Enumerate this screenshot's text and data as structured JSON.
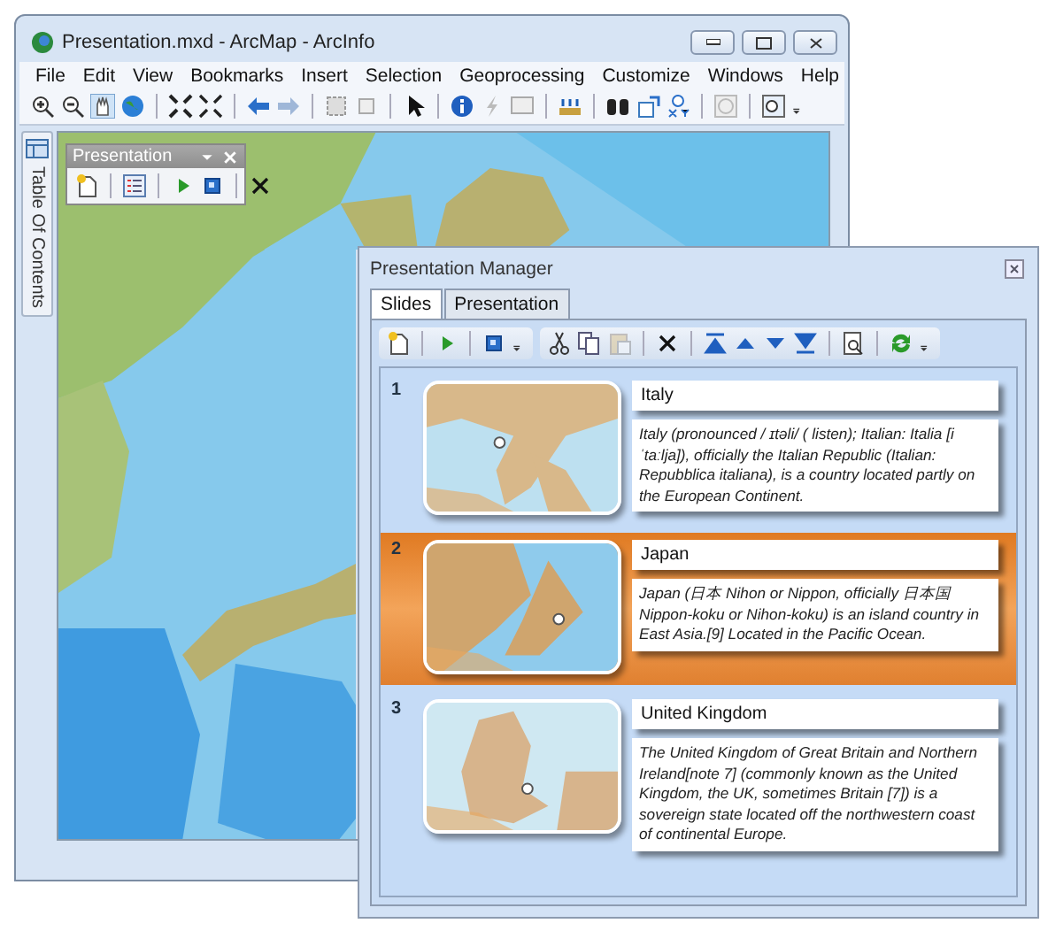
{
  "main_window": {
    "title": "Presentation.mxd - ArcMap - ArcInfo",
    "menu": [
      "File",
      "Edit",
      "View",
      "Bookmarks",
      "Insert",
      "Selection",
      "Geoprocessing",
      "Customize",
      "Windows",
      "Help"
    ],
    "toc_tab": "Table Of Contents",
    "floating_toolbar": {
      "title": "Presentation"
    }
  },
  "manager": {
    "title": "Presentation Manager",
    "tabs": [
      {
        "label": "Slides",
        "selected": true
      },
      {
        "label": "Presentation",
        "selected": false
      }
    ],
    "slides": [
      {
        "number": "1",
        "title": "Italy",
        "description": "Italy (pronounced / ɪtəli/ ( listen); Italian: Italia [iˈtaːlja]), officially the Italian Republic (Italian: Repubblica italiana), is a country located partly on the European Continent.",
        "selected": false
      },
      {
        "number": "2",
        "title": "Japan",
        "description": "Japan (日本 Nihon or Nippon, officially 日本国 Nippon-koku or Nihon-koku) is an island country in East Asia.[9] Located in the Pacific Ocean.",
        "selected": true
      },
      {
        "number": "3",
        "title": "United Kingdom",
        "description": "The United Kingdom of Great Britain and Northern Ireland[note 7] (commonly known as the United Kingdom, the UK, sometimes Britain [7]) is a sovereign state located off the northwestern coast of continental Europe.",
        "selected": false
      }
    ]
  }
}
